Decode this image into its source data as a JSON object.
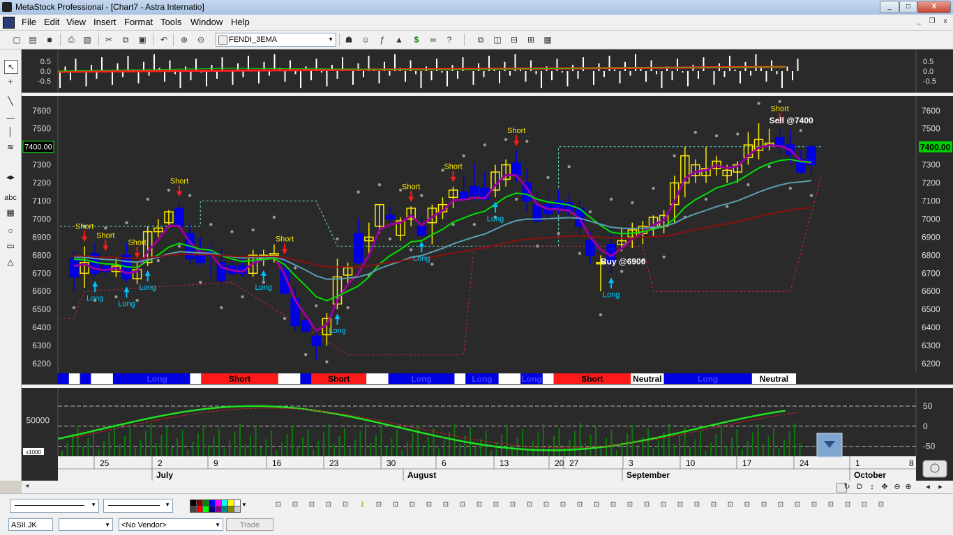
{
  "window": {
    "title": "MetaStock Professional - [Chart7 - Astra Internatio]",
    "minimize": "_",
    "maximize": "□",
    "close": "X"
  },
  "menu": {
    "items": [
      "File",
      "Edit",
      "View",
      "Insert",
      "Format",
      "Tools",
      "Window",
      "Help"
    ],
    "mdi_min": "_",
    "mdi_restore": "❐",
    "mdi_close": "x"
  },
  "toolbar": {
    "template_select": "FENDI_3EMA",
    "icons": [
      "new-icon",
      "open-icon",
      "save-icon",
      "print-icon",
      "print-preview-icon",
      "cut-icon",
      "copy-icon",
      "paste-icon",
      "undo-icon",
      "crosshair-icon",
      "zoom-icon",
      "template-icon",
      "explorer-icon",
      "expert-icon",
      "formula-icon",
      "system-tester-icon",
      "dollar-icon",
      "binoculars-icon",
      "help-pointer-icon",
      "window-cascade-icon",
      "tile-vertical-icon",
      "tile-horizontal-icon",
      "tile-grid-icon",
      "arrange-icon"
    ]
  },
  "left_tools": [
    "pointer-icon",
    "crosshair-icon",
    "trendline-icon",
    "horizontal-line-icon",
    "vertical-line-icon",
    "fibonacci-icon",
    "adjust-icon",
    "text-icon",
    "grid-icon",
    "ellipse-icon",
    "rectangle-icon",
    "triangle-icon"
  ],
  "left_tools_text": {
    "abc": "abc"
  },
  "colors": {
    "background": "#2a2a2a",
    "bullish": "#ffea00",
    "bearish": "#0000e0",
    "ema_fast": "#a000a0",
    "ema_mid": "#00e000",
    "ema_slow": "#5aa0b0",
    "ema_long": "#8b1010",
    "signal_long": "#00c0ff",
    "signal_short": "#ff1a1a",
    "label_yellow": "#ffea00",
    "label_cyan": "#00d0ff"
  },
  "chart_data": {
    "type": "candlestick",
    "price_axis": {
      "ticks": [
        "7600",
        "7500",
        "7400",
        "7300",
        "7200",
        "7100",
        "7000",
        "6900",
        "6800",
        "6700",
        "6600",
        "6500",
        "6400",
        "6300",
        "6200"
      ],
      "ylim": [
        6150,
        7680
      ],
      "current_value": "7400.00"
    },
    "oscillator_top": {
      "ticks": [
        "0.5",
        "0.0",
        "-0.5"
      ],
      "ylim": [
        -1,
        1
      ]
    },
    "bottom_panel": {
      "left_ticks": [
        "50000"
      ],
      "left_scale": "x1000",
      "right_ticks": [
        "50",
        "0",
        "-50"
      ],
      "ylim": [
        -75,
        95
      ]
    },
    "time_axis": {
      "day_labels": [
        "25",
        "2",
        "9",
        "16",
        "23",
        "30",
        "6",
        "13",
        "20",
        "27",
        "3",
        "10",
        "17",
        "24",
        "1"
      ],
      "month_labels": [
        "July",
        "August",
        "September",
        "October"
      ],
      "trailing_label": "8"
    },
    "candles": [
      {
        "o": 6780,
        "h": 6820,
        "l": 6600,
        "c": 6680
      },
      {
        "o": 6700,
        "h": 6850,
        "l": 6620,
        "c": 6760
      },
      {
        "o": 6810,
        "h": 6870,
        "l": 6680,
        "c": 6700
      },
      {
        "o": 6740,
        "h": 6800,
        "l": 6680,
        "c": 6710
      },
      {
        "o": 6710,
        "h": 6780,
        "l": 6680,
        "c": 6740
      },
      {
        "o": 6800,
        "h": 6870,
        "l": 6650,
        "c": 6670
      },
      {
        "o": 6670,
        "h": 6760,
        "l": 6640,
        "c": 6720
      },
      {
        "o": 6760,
        "h": 6960,
        "l": 6740,
        "c": 6930
      },
      {
        "o": 6930,
        "h": 7000,
        "l": 6900,
        "c": 6950
      },
      {
        "o": 6980,
        "h": 7050,
        "l": 6950,
        "c": 7040
      },
      {
        "o": 7060,
        "h": 7100,
        "l": 6960,
        "c": 6960
      },
      {
        "o": 6920,
        "h": 6980,
        "l": 6750,
        "c": 6780
      },
      {
        "o": 6800,
        "h": 6900,
        "l": 6740,
        "c": 6760
      },
      {
        "o": 6820,
        "h": 6860,
        "l": 6680,
        "c": 6800
      },
      {
        "o": 6760,
        "h": 6840,
        "l": 6640,
        "c": 6660
      },
      {
        "o": 6740,
        "h": 6780,
        "l": 6680,
        "c": 6700
      },
      {
        "o": 6740,
        "h": 6790,
        "l": 6680,
        "c": 6700
      },
      {
        "o": 6700,
        "h": 6830,
        "l": 6680,
        "c": 6800
      },
      {
        "o": 6780,
        "h": 6830,
        "l": 6740,
        "c": 6800
      },
      {
        "o": 6800,
        "h": 6860,
        "l": 6760,
        "c": 6810
      },
      {
        "o": 6720,
        "h": 6780,
        "l": 6580,
        "c": 6590
      },
      {
        "o": 6560,
        "h": 6620,
        "l": 6380,
        "c": 6410
      },
      {
        "o": 6440,
        "h": 6480,
        "l": 6360,
        "c": 6380
      },
      {
        "o": 6350,
        "h": 6370,
        "l": 6220,
        "c": 6300
      },
      {
        "o": 6360,
        "h": 6480,
        "l": 6300,
        "c": 6450
      },
      {
        "o": 6530,
        "h": 6780,
        "l": 6500,
        "c": 6680
      },
      {
        "o": 6690,
        "h": 6760,
        "l": 6640,
        "c": 6730
      },
      {
        "o": 6920,
        "h": 7000,
        "l": 6750,
        "c": 6760
      },
      {
        "o": 6880,
        "h": 6980,
        "l": 6800,
        "c": 6900
      },
      {
        "o": 6960,
        "h": 7080,
        "l": 6920,
        "c": 7080
      },
      {
        "o": 7020,
        "h": 7070,
        "l": 6980,
        "c": 7000
      },
      {
        "o": 6910,
        "h": 7010,
        "l": 6880,
        "c": 6990
      },
      {
        "o": 7000,
        "h": 7070,
        "l": 6960,
        "c": 7060
      },
      {
        "o": 6960,
        "h": 7020,
        "l": 6900,
        "c": 6910
      },
      {
        "o": 6980,
        "h": 7080,
        "l": 6860,
        "c": 7060
      },
      {
        "o": 7040,
        "h": 7120,
        "l": 7000,
        "c": 7080
      },
      {
        "o": 7120,
        "h": 7180,
        "l": 7060,
        "c": 7160
      },
      {
        "o": 7150,
        "h": 7240,
        "l": 7100,
        "c": 7110
      },
      {
        "o": 7180,
        "h": 7310,
        "l": 7100,
        "c": 7130
      },
      {
        "o": 7170,
        "h": 7260,
        "l": 7100,
        "c": 7110
      },
      {
        "o": 7160,
        "h": 7300,
        "l": 7120,
        "c": 7260
      },
      {
        "o": 7220,
        "h": 7330,
        "l": 7180,
        "c": 7300
      },
      {
        "o": 7310,
        "h": 7380,
        "l": 7200,
        "c": 7240
      },
      {
        "o": 7200,
        "h": 7280,
        "l": 7040,
        "c": 7100
      },
      {
        "o": 7080,
        "h": 7150,
        "l": 6980,
        "c": 6990
      },
      {
        "o": 7080,
        "h": 7120,
        "l": 7000,
        "c": 7030
      },
      {
        "o": 7100,
        "h": 7160,
        "l": 7030,
        "c": 7050
      },
      {
        "o": 7090,
        "h": 7140,
        "l": 7000,
        "c": 7040
      },
      {
        "o": 7060,
        "h": 7110,
        "l": 6900,
        "c": 6960
      },
      {
        "o": 6880,
        "h": 6930,
        "l": 6750,
        "c": 6800
      },
      {
        "o": 6760,
        "h": 6800,
        "l": 6600,
        "c": 6760
      },
      {
        "o": 6860,
        "h": 6960,
        "l": 6700,
        "c": 6760
      },
      {
        "o": 6860,
        "h": 6950,
        "l": 6820,
        "c": 6880
      },
      {
        "o": 6900,
        "h": 6980,
        "l": 6840,
        "c": 6940
      },
      {
        "o": 6920,
        "h": 6990,
        "l": 6860,
        "c": 6960
      },
      {
        "o": 6950,
        "h": 7020,
        "l": 6900,
        "c": 7010
      },
      {
        "o": 6960,
        "h": 7050,
        "l": 6920,
        "c": 7020
      },
      {
        "o": 7080,
        "h": 7240,
        "l": 6980,
        "c": 7200
      },
      {
        "o": 7200,
        "h": 7400,
        "l": 7120,
        "c": 7350
      },
      {
        "o": 7240,
        "h": 7330,
        "l": 7200,
        "c": 7300
      },
      {
        "o": 7240,
        "h": 7400,
        "l": 7200,
        "c": 7280
      },
      {
        "o": 7280,
        "h": 7350,
        "l": 7240,
        "c": 7320
      },
      {
        "o": 7240,
        "h": 7300,
        "l": 7200,
        "c": 7270
      },
      {
        "o": 7260,
        "h": 7320,
        "l": 7200,
        "c": 7300
      },
      {
        "o": 7340,
        "h": 7480,
        "l": 7300,
        "c": 7410
      },
      {
        "o": 7380,
        "h": 7530,
        "l": 7330,
        "c": 7440
      },
      {
        "o": 7410,
        "h": 7500,
        "l": 7380,
        "c": 7420
      },
      {
        "o": 7450,
        "h": 7500,
        "l": 7360,
        "c": 7400
      },
      {
        "o": 7410,
        "h": 7490,
        "l": 7300,
        "c": 7360
      },
      {
        "o": 7330,
        "h": 7380,
        "l": 7250,
        "c": 7260
      },
      {
        "o": 7400,
        "h": 7420,
        "l": 7240,
        "c": 7300
      }
    ],
    "annotations": [
      {
        "text": "Short",
        "type": "short",
        "i": 1
      },
      {
        "text": "Short",
        "type": "short",
        "i": 3
      },
      {
        "text": "Short",
        "type": "short",
        "i": 6
      },
      {
        "text": "Short",
        "type": "short",
        "i": 10
      },
      {
        "text": "Short",
        "type": "short",
        "i": 20
      },
      {
        "text": "Short",
        "type": "short",
        "i": 32
      },
      {
        "text": "Short",
        "type": "short",
        "i": 36
      },
      {
        "text": "Short",
        "type": "short",
        "i": 42
      },
      {
        "text": "Short",
        "type": "short",
        "i": 67
      },
      {
        "text": "Long",
        "type": "long",
        "i": 2
      },
      {
        "text": "Long",
        "type": "long",
        "i": 5
      },
      {
        "text": "Long",
        "type": "long",
        "i": 7
      },
      {
        "text": "Long",
        "type": "long",
        "i": 18
      },
      {
        "text": "Long",
        "type": "long",
        "i": 25
      },
      {
        "text": "Long",
        "type": "long",
        "i": 33
      },
      {
        "text": "Long",
        "type": "long",
        "i": 40
      },
      {
        "text": "Long",
        "type": "long",
        "i": 51
      }
    ],
    "text_notes": [
      {
        "text": "Sell @7400",
        "i": 66,
        "price": 7530
      },
      {
        "text": "Buy @6900",
        "i": 50,
        "price": 6750
      }
    ],
    "signal_bar": [
      {
        "label": "",
        "color": "blue",
        "span": 1
      },
      {
        "label": "",
        "color": "white",
        "span": 1
      },
      {
        "label": "",
        "color": "blue",
        "span": 1
      },
      {
        "label": "",
        "color": "white",
        "span": 2
      },
      {
        "label": "",
        "color": "blue",
        "span": 1
      },
      {
        "label": "Long",
        "color": "blue",
        "span": 6
      },
      {
        "label": "",
        "color": "white",
        "span": 1
      },
      {
        "label": "Short",
        "color": "red",
        "span": 7
      },
      {
        "label": "",
        "color": "white",
        "span": 2
      },
      {
        "label": "",
        "color": "blue",
        "span": 1
      },
      {
        "label": "Short",
        "color": "red",
        "span": 5
      },
      {
        "label": "",
        "color": "white",
        "span": 2
      },
      {
        "label": "Long",
        "color": "blue",
        "span": 6
      },
      {
        "label": "",
        "color": "white",
        "span": 1
      },
      {
        "label": "Long",
        "color": "blue",
        "span": 3
      },
      {
        "label": "",
        "color": "white",
        "span": 2
      },
      {
        "label": "Long",
        "color": "blue",
        "span": 2
      },
      {
        "label": "",
        "color": "white",
        "span": 1
      },
      {
        "label": "Short",
        "color": "red",
        "span": 7
      },
      {
        "label": "Neutral",
        "color": "white",
        "span": 3
      },
      {
        "label": "Long",
        "color": "blue",
        "span": 8
      },
      {
        "label": "Neutral",
        "color": "white",
        "span": 4
      }
    ]
  },
  "bottom_toolbar": {
    "symbol": "ASII.JK",
    "vendor": "<No Vendor>",
    "trade": "Trade",
    "first_select": ""
  }
}
